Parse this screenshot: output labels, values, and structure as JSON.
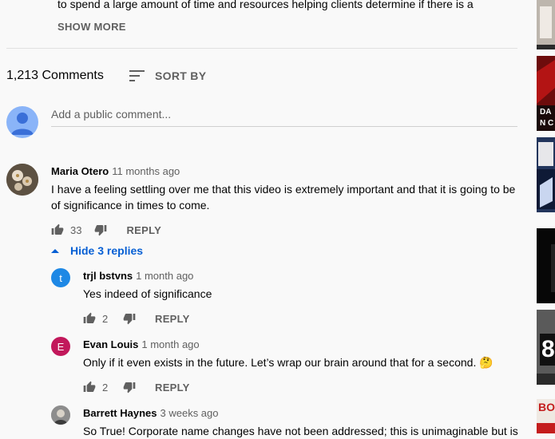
{
  "description": {
    "text": "to spend a large amount of time and resources helping clients determine if there is a",
    "show_more": "SHOW MORE"
  },
  "comments_header": {
    "count": "1,213 Comments",
    "sort_label": "SORT BY"
  },
  "add_comment": {
    "placeholder": "Add a public comment..."
  },
  "comments": [
    {
      "author": "Maria Otero",
      "time": "11 months ago",
      "text_line1": "I have a feeling settling over me that this video is extremely important and that it is going to be",
      "text_line2": "of significance in times to come.",
      "likes": "33",
      "reply_label": "REPLY"
    }
  ],
  "hide_replies": "Hide 3 replies",
  "replies": [
    {
      "author": "trjl bstvns",
      "initial": "t",
      "time": "1 month ago",
      "text": "Yes indeed of significance",
      "likes": "2",
      "reply_label": "REPLY"
    },
    {
      "author": "Evan Louis",
      "initial": "E",
      "time": "1 month ago",
      "text": "Only if it even exists in the future. Let’s wrap our brain around that for a second. 🤔",
      "likes": "2",
      "reply_label": "REPLY"
    },
    {
      "author": "Barrett Haynes",
      "time": "3 weeks ago",
      "text": "So True! Corporate name changes have not been addressed; this is unimaginable but is"
    }
  ],
  "colors": {
    "link_blue": "#065fd4",
    "avatar_t": "#1e88e5",
    "avatar_e": "#c2185b",
    "avatar_me": "#8ab4f8"
  },
  "sidebar_thumbs": [
    {
      "label": "DAN CAR"
    },
    {
      "label": "8"
    },
    {
      "label": "BO"
    }
  ]
}
